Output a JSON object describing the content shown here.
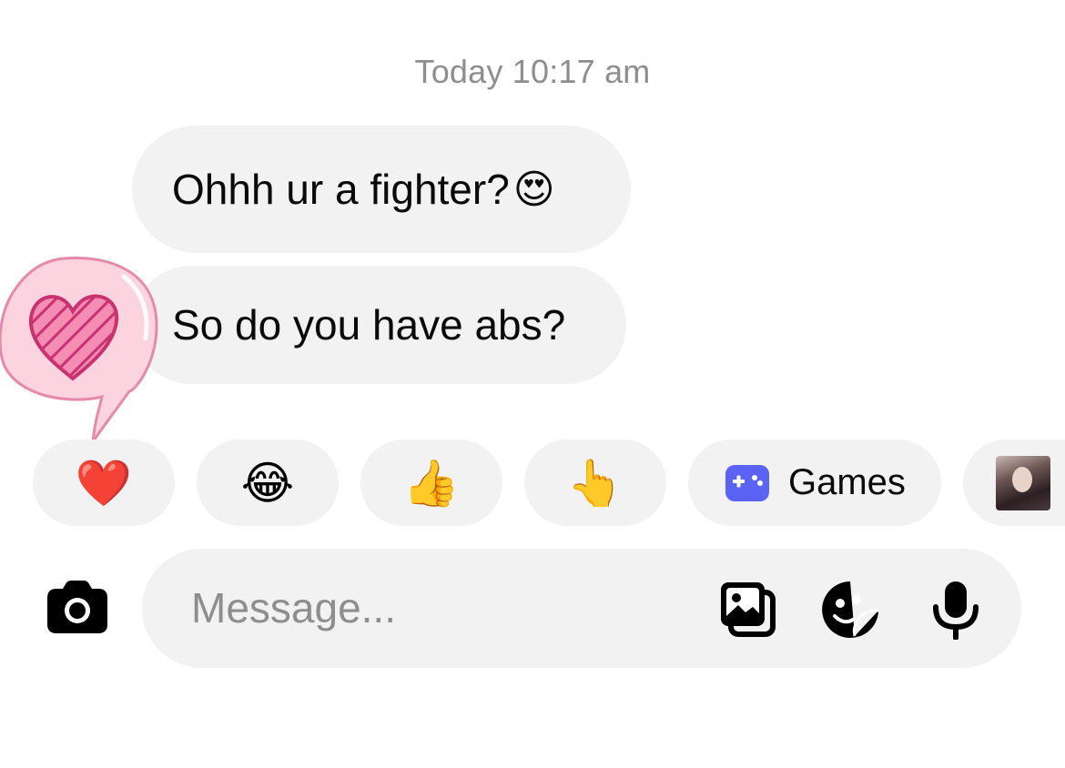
{
  "thread": {
    "timestamp": "Today 10:17 am",
    "messages": [
      {
        "text": "Ohhh ur a fighter?",
        "emoji": "😍"
      },
      {
        "text": "So do you have abs?"
      }
    ],
    "reaction_sticker": "heart-speech-bubble-icon"
  },
  "quick_replies": {
    "heart": "❤️",
    "joy": "😂",
    "thumbs_up": "👍",
    "pointing": "👆",
    "games_label": "Games",
    "games_icon": "gamepad-icon",
    "games_icon_color": "#5b63f5"
  },
  "composer": {
    "placeholder": "Message...",
    "icons": [
      "camera-icon",
      "gallery-icon",
      "sticker-icon",
      "microphone-icon"
    ]
  },
  "colors": {
    "bubble": "#f2f2f2",
    "timestamp": "#8e8e8e",
    "sticker_pink": "#f58cb4"
  }
}
